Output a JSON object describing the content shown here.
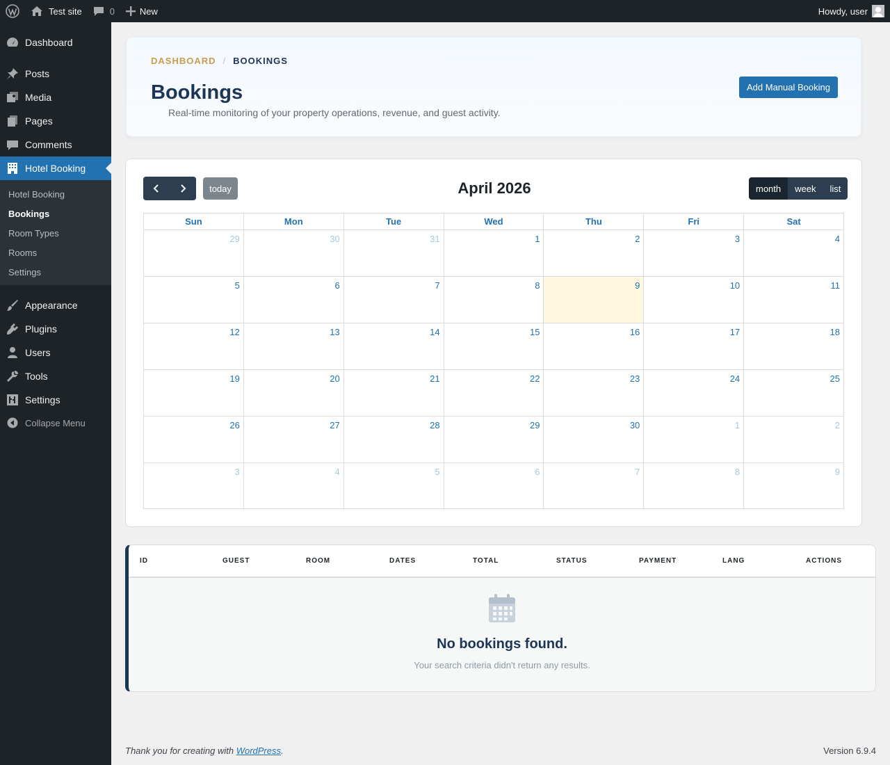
{
  "admin_bar": {
    "site_name": "Test site",
    "comments_count": "0",
    "new_label": "New",
    "greeting": "Howdy, user"
  },
  "sidebar": {
    "items": [
      {
        "label": "Dashboard",
        "icon": "dashboard-icon"
      },
      {
        "label": "Posts",
        "icon": "pin-icon"
      },
      {
        "label": "Media",
        "icon": "media-icon"
      },
      {
        "label": "Pages",
        "icon": "pages-icon"
      },
      {
        "label": "Comments",
        "icon": "comment-icon"
      },
      {
        "label": "Hotel Booking",
        "icon": "building-icon"
      },
      {
        "label": "Appearance",
        "icon": "brush-icon"
      },
      {
        "label": "Plugins",
        "icon": "plugin-icon"
      },
      {
        "label": "Users",
        "icon": "user-icon"
      },
      {
        "label": "Tools",
        "icon": "wrench-icon"
      },
      {
        "label": "Settings",
        "icon": "settings-icon"
      }
    ],
    "submenu": [
      "Hotel Booking",
      "Bookings",
      "Room Types",
      "Rooms",
      "Settings"
    ],
    "collapse_label": "Collapse Menu"
  },
  "header": {
    "breadcrumb_root": "Dashboard",
    "breadcrumb_sep": "/",
    "breadcrumb_current": "Bookings",
    "title": "Bookings",
    "subtitle": "Real-time monitoring of your property operations, revenue, and guest activity.",
    "add_button": "Add Manual Booking"
  },
  "calendar": {
    "title": "April 2026",
    "today_label": "today",
    "views": [
      "month",
      "week",
      "list"
    ],
    "active_view": "month",
    "weekdays": [
      "Sun",
      "Mon",
      "Tue",
      "Wed",
      "Thu",
      "Fri",
      "Sat"
    ],
    "weeks": [
      [
        {
          "d": "29",
          "o": true
        },
        {
          "d": "30",
          "o": true
        },
        {
          "d": "31",
          "o": true
        },
        {
          "d": "1"
        },
        {
          "d": "2"
        },
        {
          "d": "3"
        },
        {
          "d": "4"
        }
      ],
      [
        {
          "d": "5"
        },
        {
          "d": "6"
        },
        {
          "d": "7"
        },
        {
          "d": "8"
        },
        {
          "d": "9",
          "t": true
        },
        {
          "d": "10"
        },
        {
          "d": "11"
        }
      ],
      [
        {
          "d": "12"
        },
        {
          "d": "13"
        },
        {
          "d": "14"
        },
        {
          "d": "15"
        },
        {
          "d": "16"
        },
        {
          "d": "17"
        },
        {
          "d": "18"
        }
      ],
      [
        {
          "d": "19"
        },
        {
          "d": "20"
        },
        {
          "d": "21"
        },
        {
          "d": "22"
        },
        {
          "d": "23"
        },
        {
          "d": "24"
        },
        {
          "d": "25"
        }
      ],
      [
        {
          "d": "26"
        },
        {
          "d": "27"
        },
        {
          "d": "28"
        },
        {
          "d": "29"
        },
        {
          "d": "30"
        },
        {
          "d": "1",
          "o": true
        },
        {
          "d": "2",
          "o": true
        }
      ],
      [
        {
          "d": "3",
          "o": true
        },
        {
          "d": "4",
          "o": true
        },
        {
          "d": "5",
          "o": true
        },
        {
          "d": "6",
          "o": true
        },
        {
          "d": "7",
          "o": true
        },
        {
          "d": "8",
          "o": true
        },
        {
          "d": "9",
          "o": true
        }
      ]
    ]
  },
  "table": {
    "columns": [
      "ID",
      "GUEST",
      "ROOM",
      "DATES",
      "TOTAL",
      "STATUS",
      "PAYMENT",
      "LANG",
      "ACTIONS"
    ],
    "empty_title": "No bookings found.",
    "empty_subtitle": "Your search criteria didn't return any results."
  },
  "footer": {
    "thanks_prefix": "Thank you for creating with",
    "thanks_link": "WordPress",
    "thanks_suffix": ".",
    "version": "Version 6.9.4"
  }
}
